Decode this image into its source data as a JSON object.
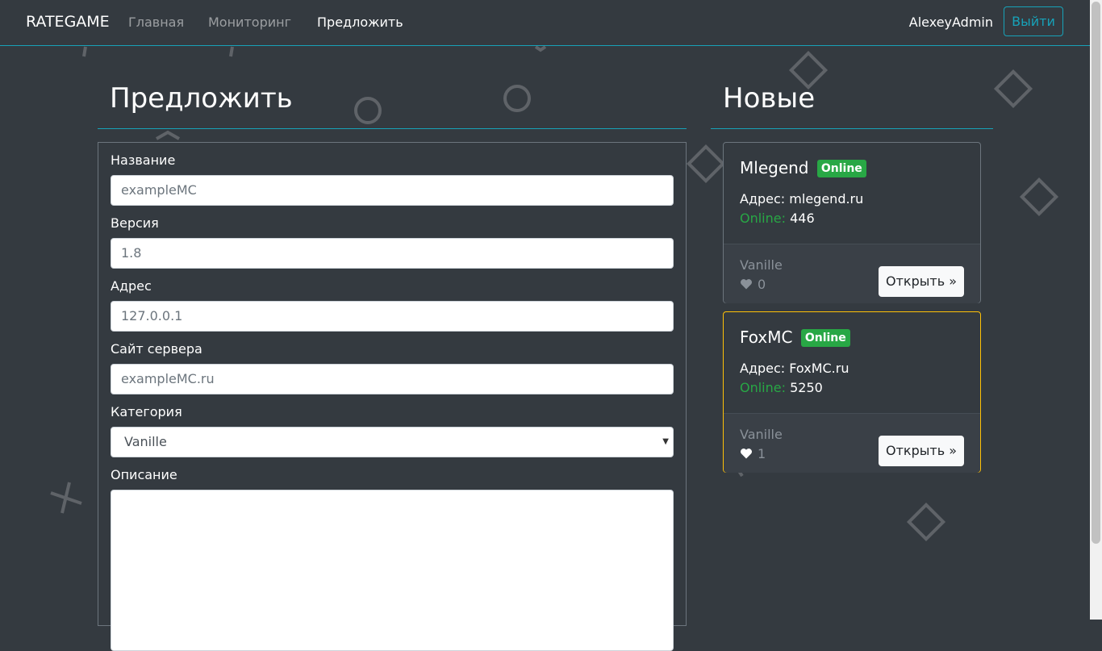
{
  "navbar": {
    "brand": "RATEGAME",
    "links": [
      {
        "label": "Главная"
      },
      {
        "label": "Мониторинг"
      },
      {
        "label": "Предложить"
      }
    ],
    "user": "AlexeyAdmin",
    "logout_label": "Выйти"
  },
  "form_section": {
    "title": "Предложить",
    "fields": {
      "name": {
        "label": "Название",
        "placeholder": "exampleMC"
      },
      "version": {
        "label": "Версия",
        "placeholder": "1.8"
      },
      "address": {
        "label": "Адрес",
        "placeholder": "127.0.0.1"
      },
      "site": {
        "label": "Сайт сервера",
        "placeholder": "exampleMC.ru"
      },
      "category": {
        "label": "Категория",
        "value": "Vanille"
      },
      "description": {
        "label": "Описание",
        "value": ""
      }
    }
  },
  "new_section": {
    "title": "Новые",
    "cards": [
      {
        "name": "Mlegend",
        "status": "Online",
        "address_label": "Адрес:",
        "address": "mlegend.ru",
        "online_label": "Online:",
        "online": "446",
        "category": "Vanille",
        "likes": "0",
        "open_label": "Открыть »"
      },
      {
        "name": "FoxMC",
        "status": "Online",
        "address_label": "Адрес:",
        "address": "FoxMC.ru",
        "online_label": "Online:",
        "online": "5250",
        "category": "Vanille",
        "likes": "1",
        "open_label": "Открыть »"
      }
    ]
  },
  "colors": {
    "background": "#343a40",
    "accent": "#17a2b8",
    "online_badge": "#28a745",
    "highlight_border": "#ffc107"
  },
  "icons": [
    "heart-icon",
    "select-caret-icon"
  ]
}
